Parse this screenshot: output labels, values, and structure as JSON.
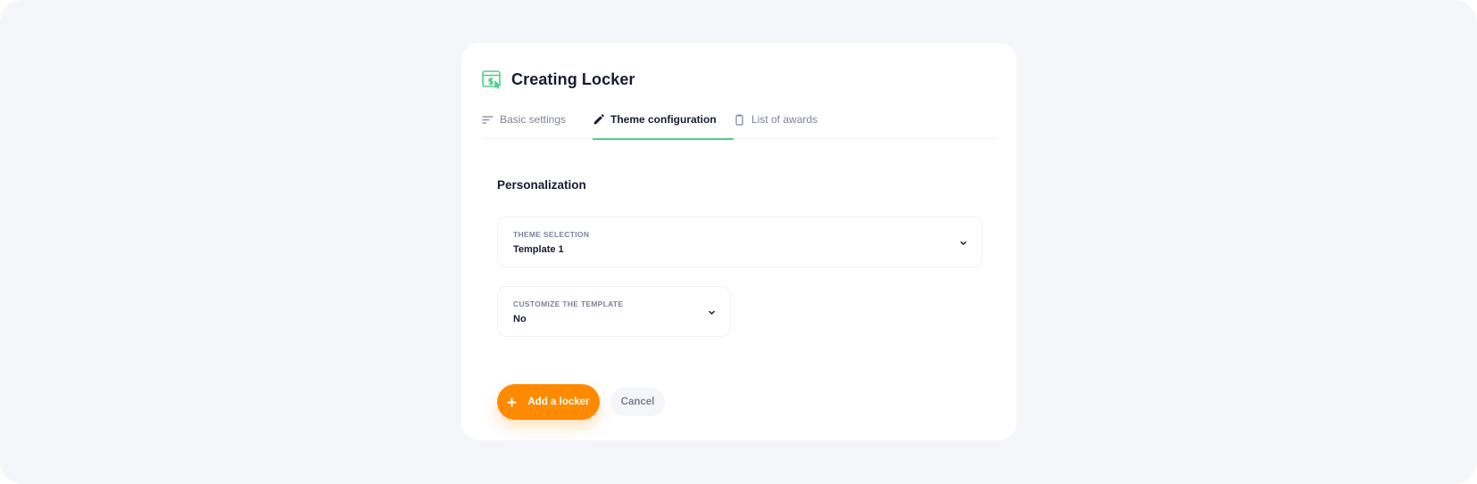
{
  "header": {
    "title": "Creating Locker",
    "icon": "money-browser-icon",
    "accent": "#50cd89"
  },
  "tabs": [
    {
      "label": "Basic settings",
      "icon": "sort-lines-icon",
      "active": false
    },
    {
      "label": "Theme configuration",
      "icon": "pencil-icon",
      "active": true
    },
    {
      "label": "List of awards",
      "icon": "clipboard-icon",
      "active": false
    }
  ],
  "section": {
    "title": "Personalization"
  },
  "fields": {
    "theme": {
      "label": "Theme selection",
      "value": "Template 1"
    },
    "customize": {
      "label": "Customize the template",
      "value": "No"
    }
  },
  "actions": {
    "add_label": "Add a locker",
    "add_color": "#ff8a00",
    "cancel_label": "Cancel"
  }
}
